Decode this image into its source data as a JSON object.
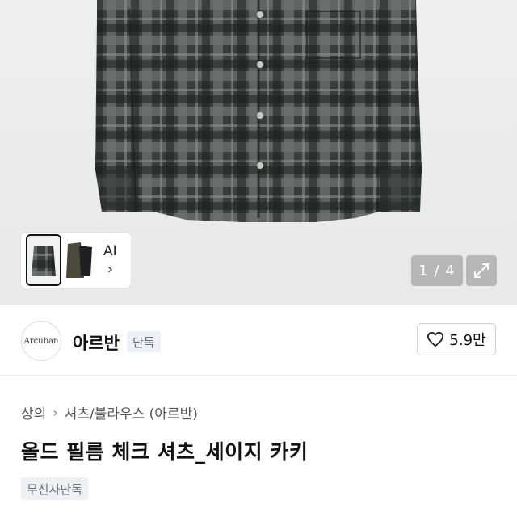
{
  "gallery": {
    "ai_label": "AI",
    "ai_chevron": "›",
    "pager_text": "1 / 4",
    "expand_icon": "expand-arrows-icon",
    "current_index": 1,
    "total": 4
  },
  "brand": {
    "logo_text": "Arcuban",
    "name": "아르반",
    "badge": "단독",
    "like_icon": "heart-outline-icon",
    "like_count": "5.9만"
  },
  "breadcrumb": {
    "items": [
      "상의",
      "셔츠/블라우스 (아르반)"
    ],
    "separator": "›"
  },
  "product": {
    "title": "올드 필름 체크 셔츠_세이지 카키",
    "tag": "무신사단독"
  },
  "colors": {
    "badge_bg": "#eef0f3",
    "badge_text": "#6a6f76",
    "shirt_dark": "#2a2d2c",
    "shirt_light": "#6e726f"
  }
}
